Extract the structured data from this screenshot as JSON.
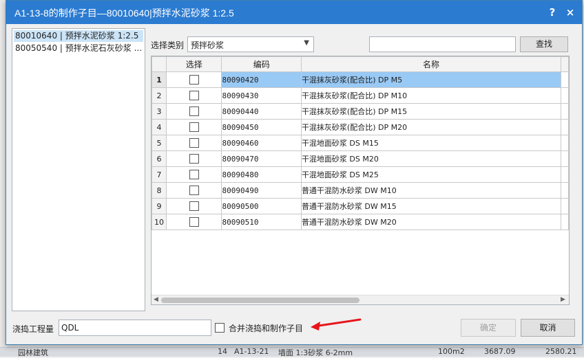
{
  "dialog": {
    "title": "A1-13-8的制作子目—80010640|预拌水泥砂浆 1:2.5",
    "help_label": "?",
    "close_label": "×"
  },
  "left_list": {
    "items": [
      {
        "label": "80010640 | 预拌水泥砂浆 1:2.5",
        "selected": true
      },
      {
        "label": "80050540 | 预拌水泥石灰砂浆 ...",
        "selected": false
      }
    ]
  },
  "filter": {
    "category_label": "选择类别",
    "category_value": "预拌砂浆",
    "search_value": "",
    "search_button": "查找"
  },
  "grid": {
    "columns": [
      "",
      "选择",
      "编码",
      "名称"
    ],
    "rows": [
      {
        "n": "1",
        "code": "80090420",
        "name": "干混抹灰砂浆(配合比) DP M5"
      },
      {
        "n": "2",
        "code": "80090430",
        "name": "干混抹灰砂浆(配合比) DP M10"
      },
      {
        "n": "3",
        "code": "80090440",
        "name": "干混抹灰砂浆(配合比) DP M15"
      },
      {
        "n": "4",
        "code": "80090450",
        "name": "干混抹灰砂浆(配合比) DP M20"
      },
      {
        "n": "5",
        "code": "80090460",
        "name": "干混地面砂浆 DS M15"
      },
      {
        "n": "6",
        "code": "80090470",
        "name": "干混地面砂浆 DS M20"
      },
      {
        "n": "7",
        "code": "80090480",
        "name": "干混地面砂浆 DS M25"
      },
      {
        "n": "8",
        "code": "80090490",
        "name": "普通干混防水砂浆 DW M10"
      },
      {
        "n": "9",
        "code": "80090500",
        "name": "普通干混防水砂浆 DW M15"
      },
      {
        "n": "10",
        "code": "80090510",
        "name": "普通干混防水砂浆 DW M20"
      }
    ],
    "highlighted_row": 1
  },
  "bottom": {
    "quantity_label": "浇捣工程量",
    "quantity_value": "QDL",
    "merge_label": "合并浇捣和制作子目",
    "ok_button": "确定",
    "cancel_button": "取消"
  },
  "background": {
    "row_num": "14",
    "row_code": "A1-13-21",
    "row_text": "墙面 1:3砂浆 6-2mm",
    "left_item": "园林建筑",
    "val1": "100m2",
    "val2": "3687.09",
    "val3": "2580.21"
  },
  "colors": {
    "titlebar": "#2b7bd1",
    "selected_row": "#99c9f5",
    "select_header": "#fde7c2",
    "annotation": "#e8141b"
  }
}
